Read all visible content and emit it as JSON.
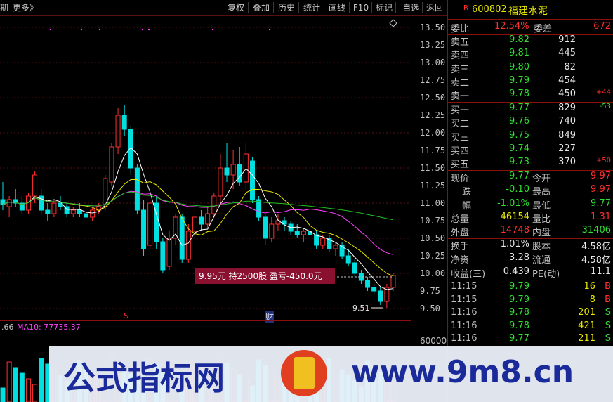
{
  "toolbar": {
    "left_label": "期",
    "more_label": "更多》",
    "buttons": [
      "复权",
      "叠加",
      "历史",
      "统计",
      "画线",
      "F10",
      "标记",
      "-自选",
      "返回"
    ]
  },
  "stock": {
    "marker": "R",
    "code": "600802",
    "name": "福建水泥"
  },
  "quote_header": {
    "weibi_label": "委比",
    "weibi_value": "12.54%",
    "weicha_label": "委差",
    "weicha_value": "672"
  },
  "sell_orders": [
    {
      "label": "卖五",
      "price": "9.82",
      "vol": "912",
      "delta": ""
    },
    {
      "label": "卖四",
      "price": "9.81",
      "vol": "445",
      "delta": ""
    },
    {
      "label": "卖三",
      "price": "9.80",
      "vol": "82",
      "delta": ""
    },
    {
      "label": "卖二",
      "price": "9.79",
      "vol": "454",
      "delta": ""
    },
    {
      "label": "卖一",
      "price": "9.78",
      "vol": "450",
      "delta": "+44"
    }
  ],
  "buy_orders": [
    {
      "label": "买一",
      "price": "9.77",
      "vol": "829",
      "delta": "-53"
    },
    {
      "label": "买二",
      "price": "9.76",
      "vol": "740",
      "delta": ""
    },
    {
      "label": "买三",
      "price": "9.75",
      "vol": "849",
      "delta": ""
    },
    {
      "label": "买四",
      "price": "9.74",
      "vol": "227",
      "delta": ""
    },
    {
      "label": "买五",
      "price": "9.73",
      "vol": "370",
      "delta": "+50"
    }
  ],
  "stats": [
    {
      "l1": "现价",
      "v1": "9.77",
      "l2": "今开",
      "v2": "9.97"
    },
    {
      "l1": "跌",
      "v1": "-0.10",
      "l2": "最高",
      "v2": "9.97"
    },
    {
      "l1": "幅",
      "v1": "-1.01%",
      "l2": "最低",
      "v2": "9.77"
    },
    {
      "l1": "总量",
      "v1": "46154",
      "l2": "量比",
      "v2": "1.31"
    },
    {
      "l1": "外盘",
      "v1": "14748",
      "l2": "内盘",
      "v2": "31406"
    }
  ],
  "stats2": [
    {
      "l1": "换手",
      "v1": "1.01%",
      "l2": "股本",
      "v2": "4.58亿"
    },
    {
      "l1": "净资",
      "v1": "3.28",
      "l2": "流通",
      "v2": "4.58亿"
    },
    {
      "l1": "收益(三)",
      "v1": "0.439",
      "l2": "PE(动)",
      "v2": "11.1"
    }
  ],
  "ticks": [
    {
      "time": "11:15",
      "price": "9.79",
      "vol": "16",
      "side": "B"
    },
    {
      "time": "11:15",
      "price": "9.79",
      "vol": "8",
      "side": "B"
    },
    {
      "time": "11:16",
      "price": "9.78",
      "vol": "201",
      "side": "S"
    },
    {
      "time": "11:16",
      "price": "9.78",
      "vol": "421",
      "side": "S"
    },
    {
      "time": "11:16",
      "price": "9.77",
      "vol": "211",
      "side": "S"
    }
  ],
  "y_axis": [
    "13.50",
    "13.25",
    "13.00",
    "12.75",
    "12.50",
    "12.25",
    "12.00",
    "11.75",
    "11.50",
    "11.25",
    "11.00",
    "10.75",
    "10.50",
    "10.25",
    "10.00",
    "9.75",
    "9.50"
  ],
  "trade_box": "9.95元 持2500股   盈亏-450.0元",
  "low_label": "9.51",
  "marker_s": "$",
  "marker_cai": "财",
  "volume_caption": {
    "prefix": ".66",
    "ma_text": "MA10: 77735.37"
  },
  "volume_tick": "60000",
  "watermark": {
    "left_text": "公式指标网",
    "right_text": "www.9m8.cn"
  },
  "colors": {
    "up": "#ff3030",
    "down": "#00e0e0",
    "ma5": "#ffffff",
    "ma10": "#e8e800",
    "ma20": "#ff40ff",
    "ma60": "#20c020"
  },
  "chart_data": {
    "type": "candlestick",
    "ylim": [
      9.35,
      13.6
    ],
    "candles": [
      {
        "o": 11.05,
        "h": 11.3,
        "l": 10.9,
        "c": 10.98
      },
      {
        "o": 10.95,
        "h": 11.1,
        "l": 10.8,
        "c": 11.05
      },
      {
        "o": 11.05,
        "h": 11.2,
        "l": 10.95,
        "c": 11.0
      },
      {
        "o": 11.0,
        "h": 11.1,
        "l": 10.85,
        "c": 10.9
      },
      {
        "o": 10.9,
        "h": 11.15,
        "l": 10.85,
        "c": 11.1
      },
      {
        "o": 11.1,
        "h": 11.45,
        "l": 11.0,
        "c": 11.4
      },
      {
        "o": 11.1,
        "h": 11.2,
        "l": 10.85,
        "c": 10.9
      },
      {
        "o": 10.9,
        "h": 11.0,
        "l": 10.75,
        "c": 10.85
      },
      {
        "o": 10.85,
        "h": 11.05,
        "l": 10.8,
        "c": 11.0
      },
      {
        "o": 11.0,
        "h": 11.1,
        "l": 10.9,
        "c": 10.95
      },
      {
        "o": 10.95,
        "h": 11.0,
        "l": 10.8,
        "c": 10.85
      },
      {
        "o": 10.85,
        "h": 10.95,
        "l": 10.8,
        "c": 10.9
      },
      {
        "o": 10.9,
        "h": 11.0,
        "l": 10.8,
        "c": 10.85
      },
      {
        "o": 10.85,
        "h": 10.95,
        "l": 10.78,
        "c": 10.8
      },
      {
        "o": 10.8,
        "h": 10.95,
        "l": 10.75,
        "c": 10.9
      },
      {
        "o": 10.9,
        "h": 11.0,
        "l": 10.85,
        "c": 10.95
      },
      {
        "o": 10.95,
        "h": 11.4,
        "l": 10.9,
        "c": 11.35
      },
      {
        "o": 11.3,
        "h": 11.85,
        "l": 11.25,
        "c": 11.8
      },
      {
        "o": 11.8,
        "h": 12.35,
        "l": 11.7,
        "c": 12.25
      },
      {
        "o": 12.25,
        "h": 12.4,
        "l": 11.95,
        "c": 12.05
      },
      {
        "o": 12.05,
        "h": 12.1,
        "l": 11.4,
        "c": 11.5
      },
      {
        "o": 11.5,
        "h": 11.55,
        "l": 10.85,
        "c": 10.9
      },
      {
        "o": 10.9,
        "h": 11.05,
        "l": 10.25,
        "c": 10.35
      },
      {
        "o": 10.4,
        "h": 11.05,
        "l": 10.35,
        "c": 11.0
      },
      {
        "o": 11.0,
        "h": 11.1,
        "l": 10.35,
        "c": 10.45
      },
      {
        "o": 10.45,
        "h": 10.5,
        "l": 10.0,
        "c": 10.05
      },
      {
        "o": 10.1,
        "h": 10.6,
        "l": 10.05,
        "c": 10.5
      },
      {
        "o": 10.5,
        "h": 10.85,
        "l": 10.4,
        "c": 10.8
      },
      {
        "o": 10.8,
        "h": 10.85,
        "l": 10.15,
        "c": 10.2
      },
      {
        "o": 10.2,
        "h": 10.7,
        "l": 10.15,
        "c": 10.6
      },
      {
        "o": 10.6,
        "h": 10.9,
        "l": 10.5,
        "c": 10.8
      },
      {
        "o": 10.8,
        "h": 10.9,
        "l": 10.6,
        "c": 10.7
      },
      {
        "o": 10.7,
        "h": 10.95,
        "l": 10.65,
        "c": 10.85
      },
      {
        "o": 10.85,
        "h": 11.15,
        "l": 10.8,
        "c": 11.1
      },
      {
        "o": 11.1,
        "h": 11.7,
        "l": 11.0,
        "c": 11.5
      },
      {
        "o": 11.5,
        "h": 11.85,
        "l": 11.3,
        "c": 11.4
      },
      {
        "o": 11.4,
        "h": 11.75,
        "l": 11.2,
        "c": 11.55
      },
      {
        "o": 11.55,
        "h": 11.8,
        "l": 11.25,
        "c": 11.3
      },
      {
        "o": 11.3,
        "h": 11.85,
        "l": 11.2,
        "c": 11.7
      },
      {
        "o": 11.6,
        "h": 11.65,
        "l": 11.0,
        "c": 11.05
      },
      {
        "o": 11.05,
        "h": 11.1,
        "l": 10.75,
        "c": 10.8
      },
      {
        "o": 10.8,
        "h": 10.85,
        "l": 10.4,
        "c": 10.5
      },
      {
        "o": 10.5,
        "h": 10.8,
        "l": 10.45,
        "c": 10.7
      },
      {
        "o": 10.7,
        "h": 10.85,
        "l": 10.6,
        "c": 10.75
      },
      {
        "o": 10.75,
        "h": 10.8,
        "l": 10.6,
        "c": 10.7
      },
      {
        "o": 10.7,
        "h": 10.75,
        "l": 10.55,
        "c": 10.6
      },
      {
        "o": 10.6,
        "h": 10.7,
        "l": 10.5,
        "c": 10.55
      },
      {
        "o": 10.55,
        "h": 10.65,
        "l": 10.45,
        "c": 10.6
      },
      {
        "o": 10.6,
        "h": 10.7,
        "l": 10.5,
        "c": 10.55
      },
      {
        "o": 10.55,
        "h": 10.6,
        "l": 10.35,
        "c": 10.4
      },
      {
        "o": 10.4,
        "h": 10.55,
        "l": 10.35,
        "c": 10.5
      },
      {
        "o": 10.5,
        "h": 10.55,
        "l": 10.3,
        "c": 10.35
      },
      {
        "o": 10.35,
        "h": 10.45,
        "l": 10.25,
        "c": 10.4
      },
      {
        "o": 10.4,
        "h": 10.45,
        "l": 10.2,
        "c": 10.25
      },
      {
        "o": 10.25,
        "h": 10.35,
        "l": 10.1,
        "c": 10.15
      },
      {
        "o": 10.15,
        "h": 10.2,
        "l": 9.95,
        "c": 10.0
      },
      {
        "o": 10.0,
        "h": 10.05,
        "l": 9.85,
        "c": 9.9
      },
      {
        "o": 9.9,
        "h": 9.95,
        "l": 9.75,
        "c": 9.8
      },
      {
        "o": 9.8,
        "h": 9.85,
        "l": 9.7,
        "c": 9.75
      },
      {
        "o": 9.75,
        "h": 9.8,
        "l": 9.55,
        "c": 9.6
      },
      {
        "o": 9.6,
        "h": 9.85,
        "l": 9.51,
        "c": 9.8
      },
      {
        "o": 9.8,
        "h": 10.0,
        "l": 9.75,
        "c": 9.97
      }
    ]
  }
}
